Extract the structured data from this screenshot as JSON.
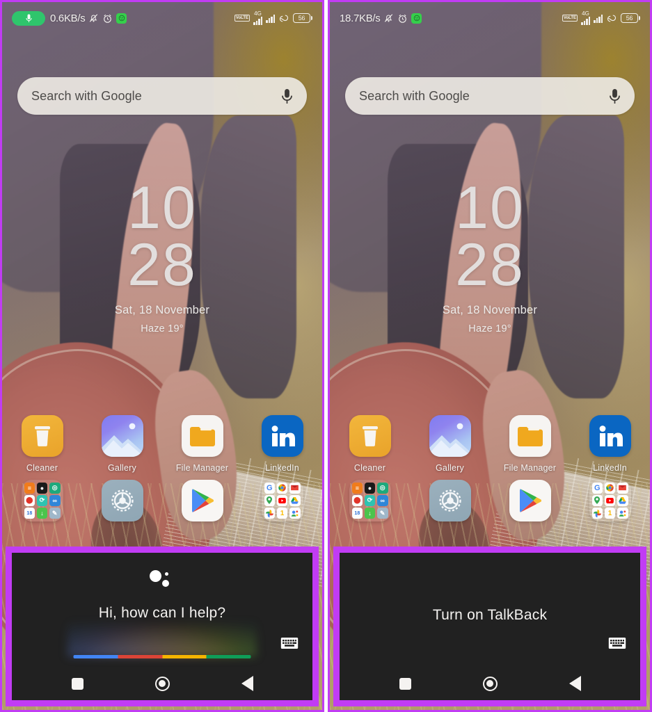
{
  "panels": [
    {
      "id": "left",
      "statusbar": {
        "mic_pill_visible": true,
        "network_speed": "0.6KB/s",
        "icons": [
          "mute-bell-icon",
          "alarm-icon",
          "green-app-chip-icon"
        ],
        "volte_label": "VoLTE",
        "network_type": "4G",
        "battery_level": "56"
      },
      "search": {
        "placeholder": "Search with Google",
        "mic": "mic-icon"
      },
      "clock": {
        "hour": "10",
        "minute": "28",
        "date": "Sat, 18 November",
        "weather": "Haze  19°"
      },
      "apps_row1": [
        {
          "label": "Cleaner",
          "icon": "cleaner-icon"
        },
        {
          "label": "Gallery",
          "icon": "gallery-icon"
        },
        {
          "label": "File Manager",
          "icon": "file-manager-icon"
        },
        {
          "label": "LinkedIn",
          "icon": "linkedin-icon"
        }
      ],
      "apps_row2": [
        {
          "label": "",
          "icon": "tools-folder-icon"
        },
        {
          "label": "",
          "icon": "settings-icon"
        },
        {
          "label": "",
          "icon": "play-store-icon"
        },
        {
          "label": "",
          "icon": "google-folder-icon"
        }
      ],
      "assistant": {
        "show_logo_dots": true,
        "prompt": "Hi, how can I help?",
        "show_colorbar": true,
        "keyboard_icon": "keyboard-icon",
        "colorbar_colors": [
          "#4285f4",
          "#db4437",
          "#f4b400",
          "#0f9d58"
        ]
      },
      "navbar": {
        "recents": "square-recents-icon",
        "home": "circle-home-icon",
        "back": "triangle-back-icon"
      }
    },
    {
      "id": "right",
      "statusbar": {
        "mic_pill_visible": false,
        "network_speed": "18.7KB/s",
        "icons": [
          "mute-bell-icon",
          "alarm-icon",
          "green-app-chip-icon"
        ],
        "volte_label": "VoLTE",
        "network_type": "4G",
        "battery_level": "56"
      },
      "search": {
        "placeholder": "Search with Google",
        "mic": "mic-icon"
      },
      "clock": {
        "hour": "10",
        "minute": "28",
        "date": "Sat, 18 November",
        "weather": "Haze  19°"
      },
      "apps_row1": [
        {
          "label": "Cleaner",
          "icon": "cleaner-icon"
        },
        {
          "label": "Gallery",
          "icon": "gallery-icon"
        },
        {
          "label": "File Manager",
          "icon": "file-manager-icon"
        },
        {
          "label": "LinkedIn",
          "icon": "linkedin-icon"
        }
      ],
      "apps_row2": [
        {
          "label": "",
          "icon": "tools-folder-icon"
        },
        {
          "label": "",
          "icon": "settings-icon"
        },
        {
          "label": "",
          "icon": "play-store-icon"
        },
        {
          "label": "",
          "icon": "google-folder-icon"
        }
      ],
      "assistant": {
        "show_logo_dots": false,
        "prompt": "Turn on TalkBack",
        "show_colorbar": false,
        "keyboard_icon": "keyboard-icon",
        "colorbar_colors": [
          "#4285f4",
          "#db4437",
          "#f4b400",
          "#0f9d58"
        ]
      },
      "navbar": {
        "recents": "square-recents-icon",
        "home": "circle-home-icon",
        "back": "triangle-back-icon"
      }
    }
  ],
  "accent": {
    "highlight_purple": "#c13cf4",
    "assistant_bg": "#212121",
    "mic_pill_green": "#2fc56c"
  }
}
